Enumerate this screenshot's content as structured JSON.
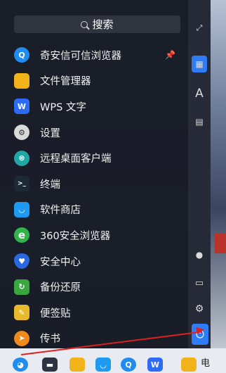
{
  "search": {
    "label": "搜索"
  },
  "apps": [
    {
      "label": "奇安信可信浏览器",
      "icon": "qianxin-browser-icon",
      "color": "#1f8df0",
      "glyph": "Q",
      "pinned": true
    },
    {
      "label": "文件管理器",
      "icon": "folder-icon",
      "color": "#f1b21a",
      "glyph": "▬",
      "pinned": false
    },
    {
      "label": "WPS 文字",
      "icon": "wps-writer-icon",
      "color": "#2d6af5",
      "glyph": "W",
      "pinned": false
    },
    {
      "label": "设置",
      "icon": "settings-gear-icon",
      "color": "#3a3d44",
      "glyph": "⚙",
      "pinned": false
    },
    {
      "label": "远程桌面客户端",
      "icon": "remote-desktop-icon",
      "color": "#21a6a6",
      "glyph": "⊗",
      "pinned": false
    },
    {
      "label": "终端",
      "icon": "terminal-icon",
      "color": "#1d2a35",
      "glyph": ">_",
      "pinned": false
    },
    {
      "label": "软件商店",
      "icon": "software-store-icon",
      "color": "#1e9af0",
      "glyph": "◡",
      "pinned": false
    },
    {
      "label": "360安全浏览器",
      "icon": "360-browser-icon",
      "color": "#2fb34a",
      "glyph": "e",
      "pinned": false
    },
    {
      "label": "安全中心",
      "icon": "security-center-icon",
      "color": "#2a67e0",
      "glyph": "♥",
      "pinned": false
    },
    {
      "label": "备份还原",
      "icon": "backup-restore-icon",
      "color": "#39a63f",
      "glyph": "↻",
      "pinned": false
    },
    {
      "label": "便签贴",
      "icon": "sticky-notes-icon",
      "color": "#e8b92a",
      "glyph": "✎",
      "pinned": false
    },
    {
      "label": "传书",
      "icon": "chuanshu-icon",
      "color": "#f08a1d",
      "glyph": "➤",
      "pinned": false
    }
  ],
  "side_panel": {
    "fullscreen_icon": "fullscreen-icon",
    "all_apps_icon": "grid-apps-icon",
    "alphabet_icon": "letter-a-icon",
    "category_icon": "category-list-icon",
    "user_icon": "user-icon",
    "computer_icon": "computer-icon",
    "settings_icon": "settings-icon",
    "power_icon": "power-icon"
  },
  "taskbar": {
    "partial_text": "电",
    "items": [
      "start-menu-icon",
      "multitask-icon",
      "file-manager-icon",
      "software-store-icon",
      "browser-icon",
      "wps-icon",
      "file-manager-icon"
    ]
  },
  "colors": {
    "accent": "#2f7cf6",
    "annotation": "#e0201c"
  }
}
